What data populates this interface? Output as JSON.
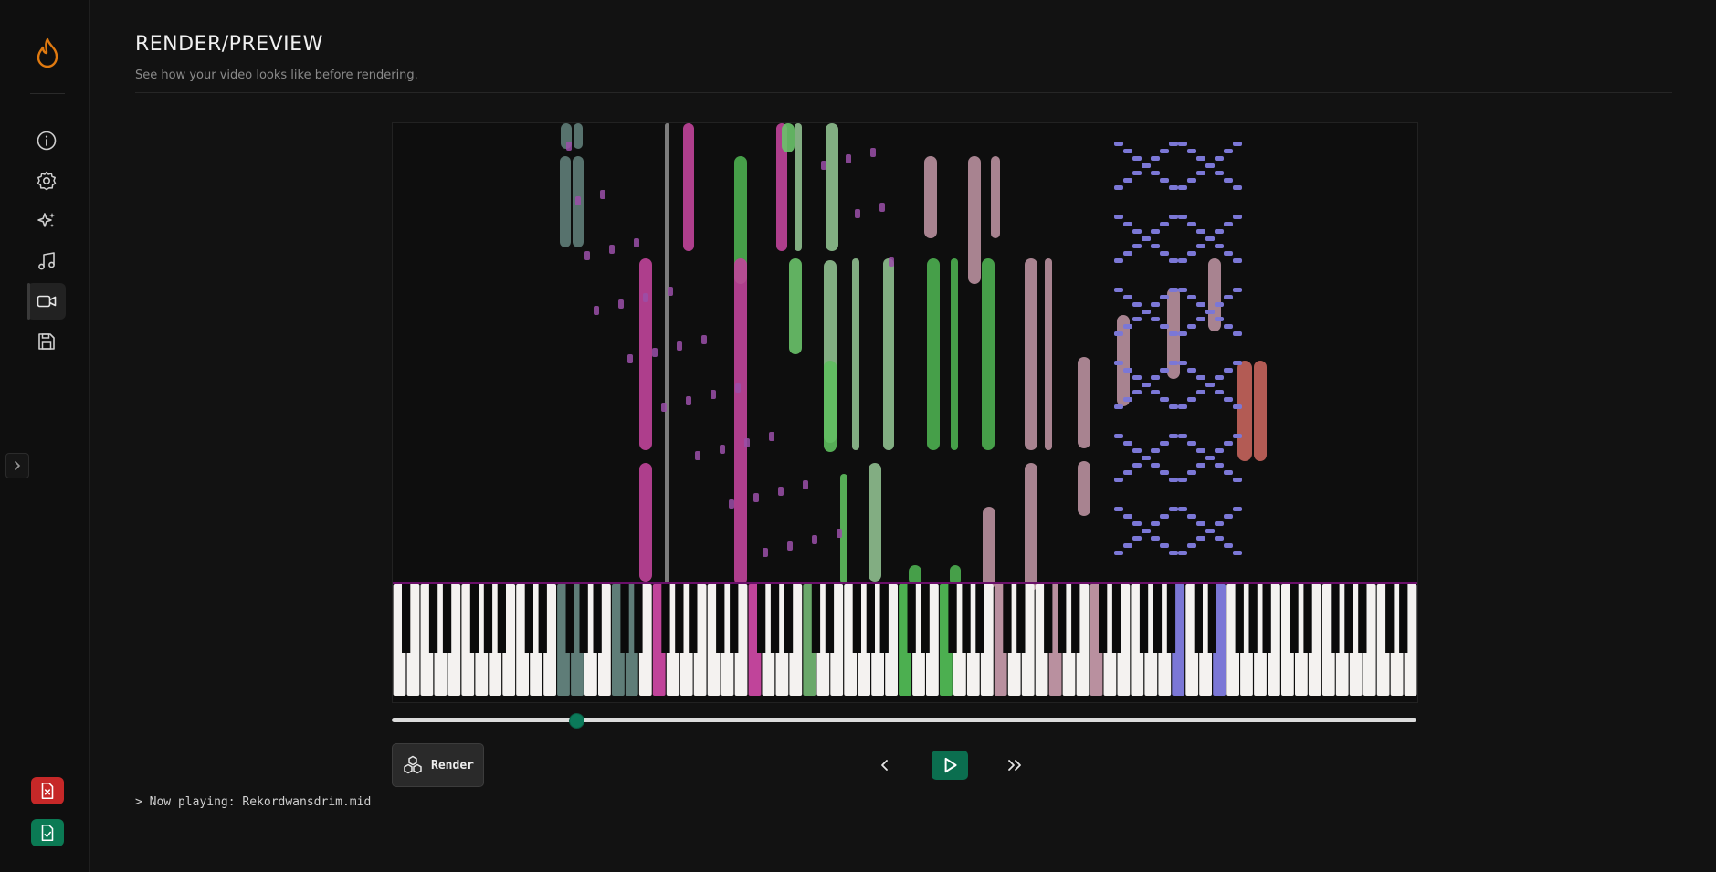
{
  "header": {
    "title": "RENDER/PREVIEW",
    "subtitle": "See how your video looks like before rendering."
  },
  "sidebar": {
    "items": [
      {
        "icon": "info-icon"
      },
      {
        "icon": "settings-gear-icon"
      },
      {
        "icon": "sparkles-icon"
      },
      {
        "icon": "music-note-icon"
      },
      {
        "icon": "video-camera-icon",
        "active": true
      },
      {
        "icon": "save-icon"
      }
    ],
    "bottom": [
      {
        "icon": "file-close-icon",
        "color": "#c62828"
      },
      {
        "icon": "file-check-icon",
        "color": "#0b7a54"
      }
    ]
  },
  "player": {
    "progress": 0.18,
    "render_label": "Render",
    "accent": "#0b6e4f"
  },
  "status": {
    "now_playing": "> Now playing: Rekordwansdrim.mid"
  }
}
